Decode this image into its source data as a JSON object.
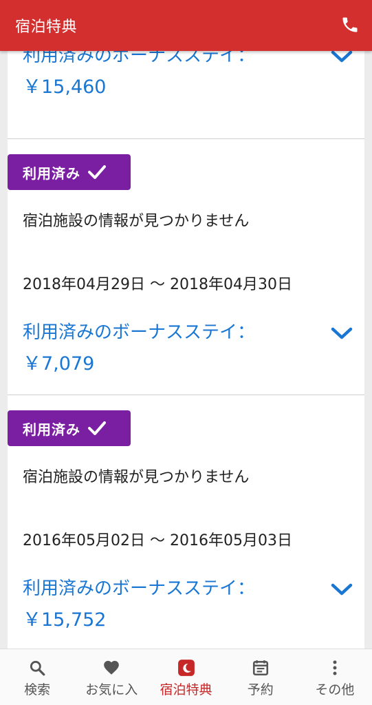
{
  "header": {
    "title": "宿泊特典",
    "phone_icon": "phone-icon",
    "bg_color": "#d32f2f"
  },
  "cards": [
    {
      "bonus_label": "利用済みのボーナスステイ：",
      "bonus_amount": "￥15,460"
    },
    {
      "status": "利用済み",
      "hotel_name": "宿泊施設の情報が見つかりません",
      "dates": "2018年04月29日 〜 2018年04月30日",
      "bonus_label": "利用済みのボーナスステイ：",
      "bonus_amount": "￥7,079"
    },
    {
      "status": "利用済み",
      "hotel_name": "宿泊施設の情報が見つかりません",
      "dates": "2016年05月02日 〜 2016年05月03日",
      "bonus_label": "利用済みのボーナスステイ：",
      "bonus_amount": "￥15,752"
    }
  ],
  "nav": [
    {
      "label": "検索",
      "icon": "search-icon"
    },
    {
      "label": "お気に入",
      "icon": "heart-icon"
    },
    {
      "label": "宿泊特典",
      "icon": "moon-badge-icon",
      "active": true
    },
    {
      "label": "予約",
      "icon": "calendar-icon"
    },
    {
      "label": "その他",
      "icon": "more-vert-icon"
    }
  ],
  "colors": {
    "accent_blue": "#1976d2",
    "badge_purple": "#7b1fa2",
    "active_red": "#c62828"
  }
}
